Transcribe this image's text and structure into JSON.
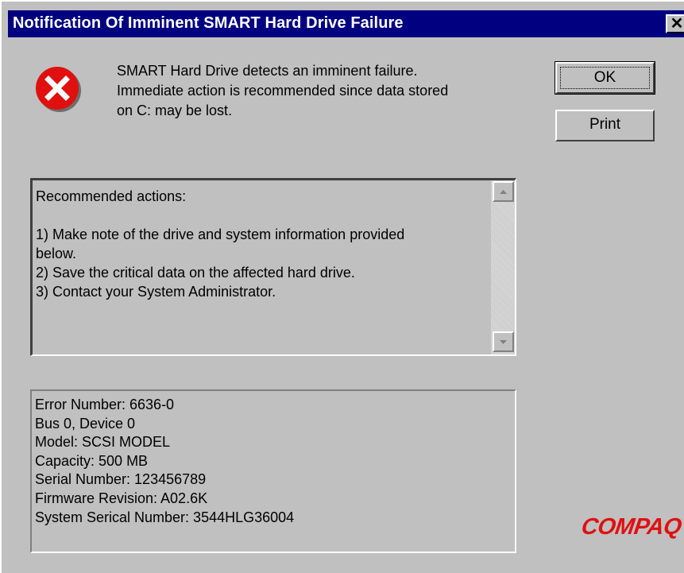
{
  "window": {
    "title": "Notification Of Imminent SMART Hard Drive Failure",
    "close_glyph": "✕"
  },
  "icon": "error-icon",
  "message": {
    "lines": [
      "SMART Hard Drive detects an imminent failure.",
      "Immediate action is recommended since data stored",
      "on C: may be lost."
    ]
  },
  "buttons": {
    "ok_label": "OK",
    "print_label": "Print"
  },
  "actions": {
    "lines": [
      "Recommended actions:",
      "",
      "1) Make note of the drive and system information provided",
      "below.",
      "2) Save the critical data on the affected hard drive.",
      "3) Contact your System Administrator."
    ]
  },
  "info": {
    "lines": [
      "Error Number: 6636-0",
      "Bus 0, Device 0",
      "Model: SCSI MODEL",
      "Capacity: 500 MB",
      "Serial Number: 123456789",
      "Firmware Revision: A02.6K",
      "System Serical Number: 3544HLG36004"
    ]
  },
  "logo": "COMPAQ",
  "colors": {
    "titlebar": "#000080",
    "error_red": "#e01010",
    "face": "#c0c0c0"
  }
}
